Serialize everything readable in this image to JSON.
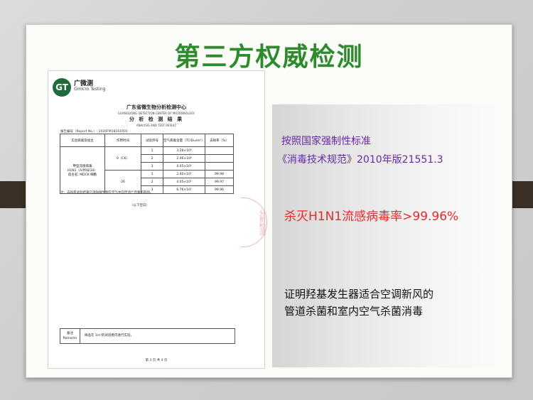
{
  "slide": {
    "title": "第三方权威检测"
  },
  "report": {
    "logo_mark": "GT",
    "logo_cn": "广微测",
    "logo_en": "Gmicro Testing",
    "org": "广东省微生物分析检测中心",
    "org_en": "GUANGDONG DETECTION CENTER OF MICROBIOLOGY",
    "doc_title": "分 析 检 测 结 果",
    "doc_title_en": "ANALYSIS AND TEST RESULT",
    "report_no": "报告编号（Report No.）: 2020FM18161R01",
    "table": {
      "headers": [
        "实验病毒及组主",
        "作用时间",
        "试验序号",
        "空气病毒含量（TCID₅₀/m³）",
        "去除率（%）"
      ],
      "virus_label_1": "甲型流感病毒",
      "virus_label_2": "H1N1（A/PR8/34）",
      "virus_label_3": "宿主名: MDCK 细胞",
      "time_ck": "0（CK）",
      "time_test": "26",
      "rows": [
        {
          "seq": "1",
          "content": "3.28×10⁶",
          "rate": ""
        },
        {
          "seq": "2",
          "content": "2.46×10⁶",
          "rate": ""
        },
        {
          "seq": "3",
          "content": "4.05×10⁶",
          "rate": ""
        },
        {
          "seq": "1",
          "content": "2.40×10²",
          "rate": "99.98"
        },
        {
          "seq": "2",
          "content": "4.05×10²",
          "rate": "99.97"
        },
        {
          "seq": "3",
          "content": "6.76×10²",
          "rate": "99.96"
        }
      ]
    },
    "note": "注：去除率试验结果已消除微生物在空气中自然消亡因素的影响。",
    "blank": "（以下空白）",
    "remarks_label": "备注",
    "remarks_label_en": "Remarks",
    "remarks_text": "样品在 1m³的试验舱内进行实验。",
    "page_no": "第 3 页 共 4 页",
    "stamp_text": "分析检测"
  },
  "panel": {
    "standard_line1": "按照国家强制性标准",
    "standard_line2": "《消毒技术规范》2010年版21551.3",
    "kill_rate": "杀灭H1N1流感病毒率>99.96%",
    "conclusion_line1": "证明羟基发生器适合空调新风的",
    "conclusion_line2": "管道杀菌和室内空气杀菌消毒"
  },
  "colors": {
    "title": "#2d8a2d",
    "standard": "#6a2aa0",
    "kill_rate": "#e12b2b",
    "frame_tabs": "#3b2f26"
  }
}
